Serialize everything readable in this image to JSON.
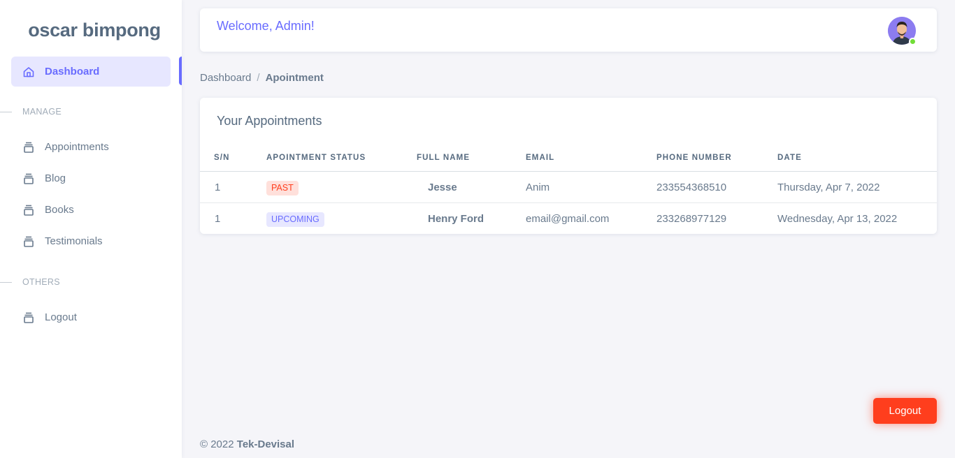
{
  "brand": {
    "name": "oscar bimpong"
  },
  "sidebar": {
    "dashboard": {
      "label": "Dashboard",
      "icon": "home-icon"
    },
    "sections": [
      {
        "header": "MANAGE",
        "items": [
          {
            "label": "Appointments",
            "icon": "stack-icon"
          },
          {
            "label": "Blog",
            "icon": "stack-icon"
          },
          {
            "label": "Books",
            "icon": "stack-icon"
          },
          {
            "label": "Testimonials",
            "icon": "stack-icon"
          }
        ]
      },
      {
        "header": "OTHERS",
        "items": [
          {
            "label": "Logout",
            "icon": "stack-icon"
          }
        ]
      }
    ]
  },
  "navbar": {
    "welcome": "Welcome, Admin!",
    "status": "online"
  },
  "breadcrumb": {
    "parent": "Dashboard",
    "separator": "/",
    "current": "Apointment"
  },
  "table": {
    "title": "Your Appointments",
    "headers": [
      "S/N",
      "APOINTMENT STATUS",
      "FULL NAME",
      "EMAIL",
      "PHONE NUMBER",
      "DATE"
    ],
    "rows": [
      {
        "sn": "1",
        "status": "PAST",
        "name": "Jesse",
        "email": "Anim",
        "phone": "233554368510",
        "date": "Thursday, Apr 7, 2022"
      },
      {
        "sn": "1",
        "status": "UPCOMING",
        "name": "Henry Ford",
        "email": "email@gmail.com",
        "phone": "233268977129",
        "date": "Wednesday, Apr 13, 2022"
      }
    ]
  },
  "footer": {
    "copyright": "© 2022",
    "owner": "Tek-Devisal"
  },
  "floating_button": {
    "label": "Logout"
  },
  "colors": {
    "primary": "#696cff",
    "danger": "#ff3e1d",
    "success": "#71dd37"
  }
}
